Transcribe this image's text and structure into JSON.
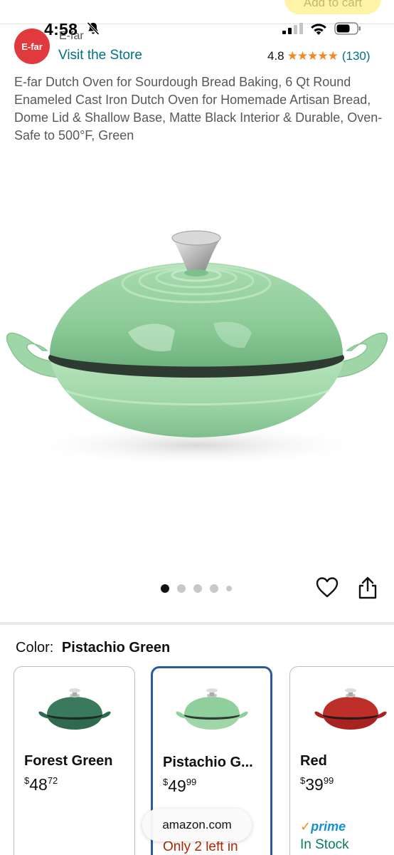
{
  "status_bar": {
    "time": "4:58",
    "add_to_cart_peek": "Add to cart"
  },
  "store": {
    "logo_text": "E-far",
    "brand_name": "E-far",
    "visit_store_label": "Visit the Store",
    "rating_value": "4.8",
    "stars": "★★★★★",
    "rating_count": "(130)"
  },
  "product": {
    "title": "E-far Dutch Oven for Sourdough Bread Baking, 6 Qt Round Enameled Cast Iron Dutch Oven for Homemade Artisan Bread, Dome Lid & Shallow Base, Matte Black Interior & Durable, Oven-Safe to 500°F, Green",
    "image_count": 5,
    "active_image_index": 0
  },
  "color_selector": {
    "label": "Color:",
    "selected": "Pistachio Green",
    "options": [
      {
        "name": "Forest Green",
        "currency": "$",
        "price_whole": "48",
        "price_fraction": "72",
        "color": "#2f6a4f"
      },
      {
        "name": "Pistachio G...",
        "currency": "$",
        "price_whole": "49",
        "price_fraction": "99",
        "color": "#8fcf9c",
        "availability": "Only 2 left in"
      },
      {
        "name": "Red",
        "currency": "$",
        "price_whole": "39",
        "price_fraction": "99",
        "color": "#a8231f",
        "badge": "prime",
        "availability": "In Stock"
      }
    ]
  },
  "browser": {
    "url": "amazon.com"
  },
  "colors": {
    "link": "#007185",
    "star": "#f08a24",
    "selected_border": "#2c5a9a",
    "in_stock": "#067d62",
    "low_stock": "#b12704",
    "pot_green": "#9fd5a6"
  }
}
